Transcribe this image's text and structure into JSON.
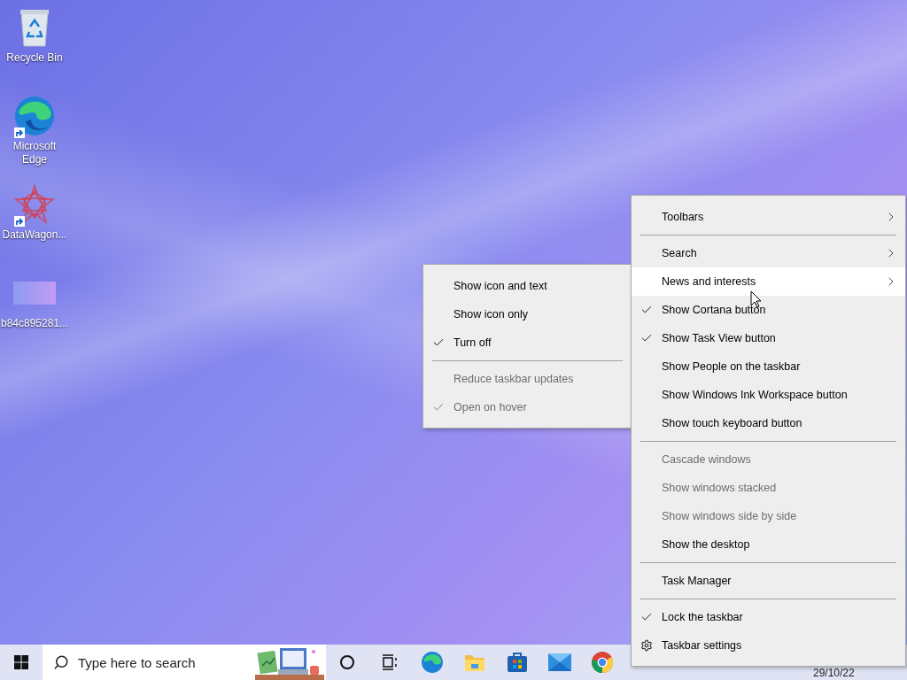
{
  "desktop_icons": [
    {
      "kind": "recycle-bin",
      "label": "Recycle Bin",
      "shortcut": false
    },
    {
      "kind": "edge",
      "label": "Microsoft Edge",
      "shortcut": true
    },
    {
      "kind": "datawagon",
      "label": "DataWagon...",
      "shortcut": true
    },
    {
      "kind": "image",
      "label": "b84c895281...",
      "shortcut": false
    }
  ],
  "context_menu": {
    "items": [
      {
        "kind": "item",
        "label": "Toolbars",
        "checked": false,
        "disabled": false,
        "has_submenu": true,
        "selected": false
      },
      {
        "kind": "separator"
      },
      {
        "kind": "item",
        "label": "Search",
        "checked": false,
        "disabled": false,
        "has_submenu": true,
        "selected": false
      },
      {
        "kind": "item",
        "label": "News and interests",
        "checked": false,
        "disabled": false,
        "has_submenu": true,
        "selected": true
      },
      {
        "kind": "item",
        "label": "Show Cortana button",
        "checked": true,
        "disabled": false,
        "has_submenu": false,
        "selected": false
      },
      {
        "kind": "item",
        "label": "Show Task View button",
        "checked": true,
        "disabled": false,
        "has_submenu": false,
        "selected": false
      },
      {
        "kind": "item",
        "label": "Show People on the taskbar",
        "checked": false,
        "disabled": false,
        "has_submenu": false,
        "selected": false
      },
      {
        "kind": "item",
        "label": "Show Windows Ink Workspace button",
        "checked": false,
        "disabled": false,
        "has_submenu": false,
        "selected": false
      },
      {
        "kind": "item",
        "label": "Show touch keyboard button",
        "checked": false,
        "disabled": false,
        "has_submenu": false,
        "selected": false
      },
      {
        "kind": "separator"
      },
      {
        "kind": "item",
        "label": "Cascade windows",
        "checked": false,
        "disabled": true,
        "has_submenu": false,
        "selected": false
      },
      {
        "kind": "item",
        "label": "Show windows stacked",
        "checked": false,
        "disabled": true,
        "has_submenu": false,
        "selected": false
      },
      {
        "kind": "item",
        "label": "Show windows side by side",
        "checked": false,
        "disabled": true,
        "has_submenu": false,
        "selected": false
      },
      {
        "kind": "item",
        "label": "Show the desktop",
        "checked": false,
        "disabled": false,
        "has_submenu": false,
        "selected": false
      },
      {
        "kind": "separator"
      },
      {
        "kind": "item",
        "label": "Task Manager",
        "checked": false,
        "disabled": false,
        "has_submenu": false,
        "selected": false
      },
      {
        "kind": "separator"
      },
      {
        "kind": "item",
        "label": "Lock the taskbar",
        "checked": true,
        "disabled": false,
        "has_submenu": false,
        "selected": false
      },
      {
        "kind": "settings",
        "label": "Taskbar settings",
        "checked": false,
        "disabled": false,
        "has_submenu": false,
        "selected": false
      }
    ]
  },
  "submenu": {
    "items": [
      {
        "kind": "item",
        "label": "Show icon and text",
        "checked": false,
        "disabled": false
      },
      {
        "kind": "item",
        "label": "Show icon only",
        "checked": false,
        "disabled": false
      },
      {
        "kind": "item",
        "label": "Turn off",
        "checked": true,
        "disabled": false
      },
      {
        "kind": "separator"
      },
      {
        "kind": "item",
        "label": "Reduce taskbar updates",
        "checked": false,
        "disabled": true
      },
      {
        "kind": "item",
        "label": "Open on hover",
        "checked": true,
        "disabled": true
      }
    ]
  },
  "taskbar": {
    "search": {
      "placeholder": "Type here to search"
    },
    "apps": [
      {
        "kind": "cortana"
      },
      {
        "kind": "task-view"
      },
      {
        "kind": "edge"
      },
      {
        "kind": "explorer"
      },
      {
        "kind": "store"
      },
      {
        "kind": "mail"
      },
      {
        "kind": "chrome"
      }
    ],
    "date": "29/10/22"
  }
}
